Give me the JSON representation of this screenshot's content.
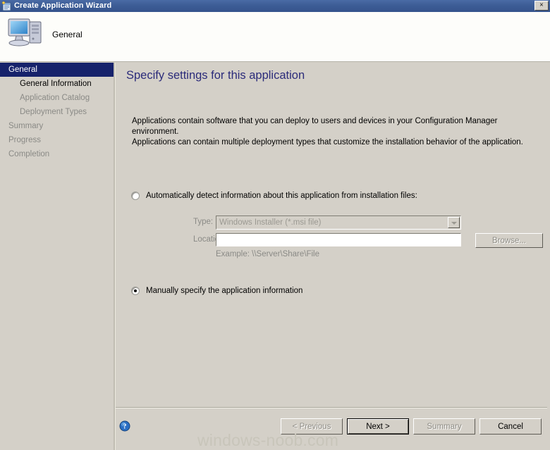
{
  "window": {
    "title": "Create Application Wizard",
    "close_label": "×",
    "icon": "wizard-app-icon"
  },
  "header": {
    "title": "General",
    "icon": "computer-icon"
  },
  "sidebar": {
    "items": [
      {
        "label": "General",
        "state": "selected",
        "indent": false
      },
      {
        "label": "General Information",
        "state": "enabled",
        "indent": true
      },
      {
        "label": "Application Catalog",
        "state": "disabled",
        "indent": true
      },
      {
        "label": "Deployment Types",
        "state": "disabled",
        "indent": true
      },
      {
        "label": "Summary",
        "state": "disabled",
        "indent": false
      },
      {
        "label": "Progress",
        "state": "disabled",
        "indent": false
      },
      {
        "label": "Completion",
        "state": "disabled",
        "indent": false
      }
    ]
  },
  "main": {
    "heading": "Specify settings for this application",
    "intro_line1": "Applications contain software that you can deploy to users and devices in your Configuration Manager environment.",
    "intro_line2": "Applications can contain multiple deployment types that customize the installation behavior of the application.",
    "option_auto": {
      "label": "Automatically detect information about this application from installation files:",
      "checked": false
    },
    "option_manual": {
      "label": "Manually specify the application information",
      "checked": true
    },
    "type_field": {
      "label": "Type:",
      "value": "Windows Installer (*.msi file)",
      "options": [
        "Windows Installer (*.msi file)"
      ]
    },
    "location_field": {
      "label": "Location:",
      "value": "",
      "placeholder": "",
      "example": "Example: \\\\Server\\Share\\File",
      "browse_label": "Browse..."
    }
  },
  "footer": {
    "help_icon": "help-icon",
    "buttons": [
      {
        "label": "< Previous",
        "state": "disabled"
      },
      {
        "label": "Next >",
        "state": "default"
      },
      {
        "label": "Summary",
        "state": "disabled"
      },
      {
        "label": "Cancel",
        "state": "enabled"
      }
    ]
  },
  "watermark": "windows-noob.com",
  "colors": {
    "titlebar": "#3d5d96",
    "panel": "#d4d0c8",
    "heading": "#2b2b7a",
    "selected_nav": "#16226b",
    "disabled_text": "#8a8a86",
    "watermark": "#c8c5ba"
  }
}
